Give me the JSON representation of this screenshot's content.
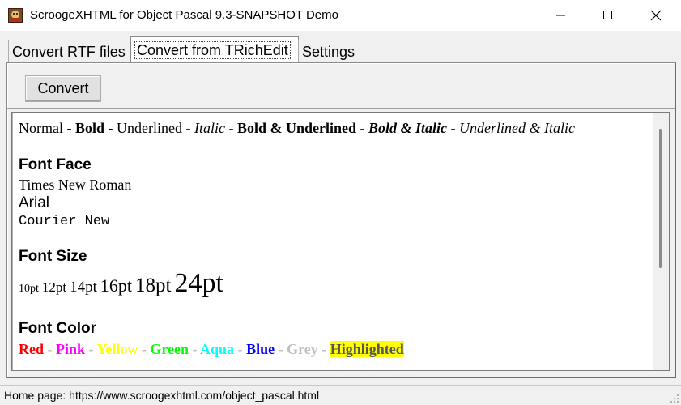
{
  "window": {
    "title": "ScroogeXHTML for Object Pascal 9.3-SNAPSHOT Demo",
    "icon": "app-logo-icon"
  },
  "tabs": [
    {
      "label": "Convert RTF files",
      "active": false
    },
    {
      "label": "Convert from TRichEdit",
      "active": true
    },
    {
      "label": "Settings",
      "active": false
    }
  ],
  "toolbar": {
    "convert_label": "Convert"
  },
  "document": {
    "styles": {
      "normal": "Normal",
      "sep": " - ",
      "bold": "Bold",
      "underlined": "Underlined",
      "italic": "Italic",
      "bold_underlined": "Bold & Underlined",
      "bold_italic": "Bold & Italic",
      "underlined_italic": "Underlined & Italic"
    },
    "font_face": {
      "heading": "Font Face",
      "times": "Times New Roman",
      "arial": "Arial",
      "courier": "Courier New"
    },
    "font_size": {
      "heading": "Font Size",
      "s10": "10pt",
      "s12": "12pt",
      "s14": "14pt",
      "s16": "16pt",
      "s18": "18pt",
      "s24": "24pt"
    },
    "font_color": {
      "heading": "Font Color",
      "sep": " - ",
      "red": "Red",
      "pink": "Pink",
      "yellow": "Yellow",
      "green": "Green",
      "aqua": "Aqua",
      "blue": "Blue",
      "grey": "Grey",
      "highlighted": "Highlighted"
    }
  },
  "colors": {
    "red": "#ff0000",
    "pink": "#ff00ff",
    "yellow": "#ffff00",
    "green": "#00ff00",
    "aqua": "#00ffff",
    "blue": "#0000ff",
    "grey": "#c0c0c0",
    "highlight_bg": "#ffff00",
    "highlight_fg": "#555555"
  },
  "status": {
    "text": "Home page: https://www.scroogexhtml.com/object_pascal.html"
  }
}
